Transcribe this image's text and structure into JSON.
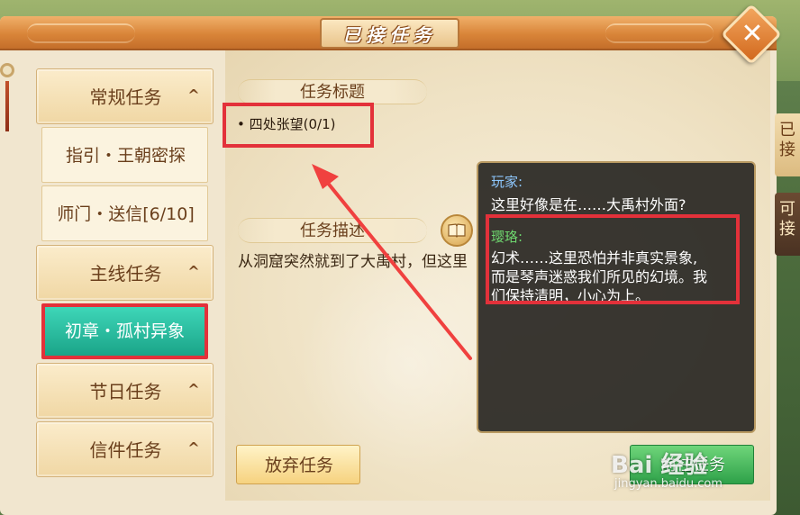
{
  "window": {
    "title": "已接任务"
  },
  "side_tabs": [
    {
      "label": "已接",
      "active": true
    },
    {
      "label": "可接",
      "active": false
    }
  ],
  "categories": {
    "regular": {
      "label": "常规任务",
      "chevron": "^"
    },
    "regular_items": [
      {
        "label": "指引・王朝密探"
      },
      {
        "label": "师门・送信[6/10]"
      }
    ],
    "main": {
      "label": "主线任务",
      "chevron": "^"
    },
    "main_items": [
      {
        "label": "初章・孤村异象",
        "selected": true
      }
    ],
    "festival": {
      "label": "节日任务",
      "chevron": "^"
    },
    "mail": {
      "label": "信件任务",
      "chevron": "^"
    }
  },
  "detail": {
    "title_header": "任务标题",
    "quest_name": "四处张望(0/1)",
    "desc_header": "任务描述",
    "desc_text": "从洞窟突然就到了大禹村，但这里",
    "abandon_label": "放弃任务",
    "goto_label": "前往任务"
  },
  "dialog": {
    "speaker1": "玩家:",
    "line1": "这里好像是在……大禹村外面?",
    "speaker2": "璎珞:",
    "lines2": [
      "幻术……这里恐怕并非真实景象,",
      "而是琴声迷惑我们所见的幻境。我",
      "们保持清明，小心为上。"
    ]
  },
  "colors": {
    "accent_red": "#e3313a",
    "selected_teal": "#1aa488",
    "player_name": "#8ec8ff",
    "npc_name": "#6fd86f",
    "brand_orange": "#d98539"
  },
  "watermark": {
    "main": "Bai 经验",
    "sub": "jingyan.baidu.com"
  }
}
